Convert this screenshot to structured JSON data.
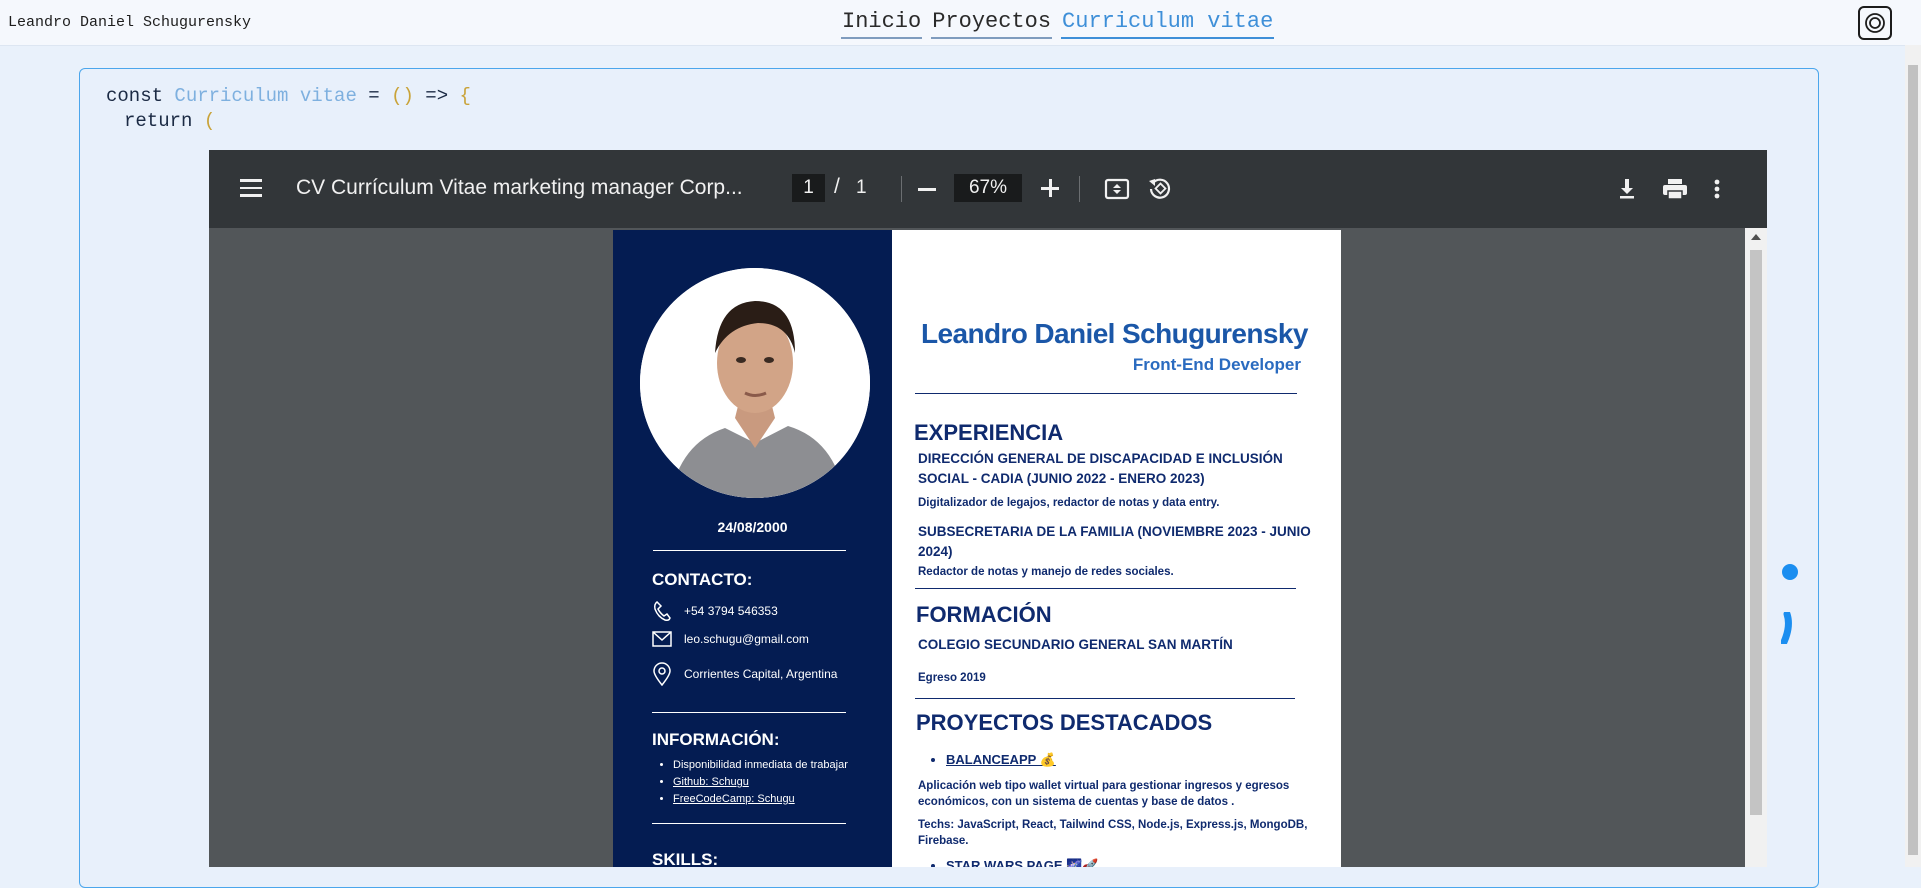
{
  "site": {
    "owner_name": "Leandro Daniel Schugurensky",
    "nav": [
      "Inicio",
      "Proyectos",
      "Curriculum vitae"
    ],
    "active_nav": "Curriculum vitae"
  },
  "code": {
    "keyword": "const",
    "component": "Curriculum vitae",
    "assign": "=",
    "parens": "()",
    "arrow": "=>",
    "brace": "{",
    "return_kw": "return",
    "open_paren": "("
  },
  "pdf_viewer": {
    "title": "CV Currículum Vitae marketing manager Corp...",
    "current_page": "1",
    "page_separator": "/",
    "total_pages": "1",
    "zoom": "67%",
    "icons": [
      "menu-icon",
      "zoom-out-icon",
      "zoom-in-icon",
      "fit-page-icon",
      "rotate-icon",
      "download-icon",
      "print-icon",
      "more-options-icon"
    ]
  },
  "cv": {
    "name": "Leandro Daniel Schugurensky",
    "role": "Front-End Developer",
    "dob": "24/08/2000",
    "contact_heading": "CONTACTO:",
    "phone": "+54 3794 546353",
    "email": "leo.schugu@gmail.com",
    "location": "Corrientes Capital, Argentina",
    "info_heading": "INFORMACIÓN:",
    "info_items": [
      "Disponibilidad inmediata de trabajar",
      "Github: Schugu",
      "FreeCodeCamp: Schugu"
    ],
    "skills_heading": "SKILLS:",
    "experience_heading": "EXPERIENCIA",
    "jobs": [
      {
        "title": "DIRECCIÓN GENERAL DE DISCAPACIDAD E INCLUSIÓN SOCIAL - CADIA (JUNIO 2022 - ENERO 2023)",
        "desc": "Digitalizador de legajos, redactor de notas y data entry."
      },
      {
        "title": "SUBSECRETARIA DE LA FAMILIA (NOVIEMBRE 2023 - JUNIO 2024)",
        "desc": "Redactor de notas y manejo de redes sociales."
      }
    ],
    "education_heading": "FORMACIÓN",
    "school": "COLEGIO SECUNDARIO GENERAL SAN MARTÍN",
    "graduation": "Egreso 2019",
    "projects_heading": "PROYECTOS DESTACADOS",
    "projects": [
      {
        "name": "BALANCEAPP 💰",
        "desc": "Aplicación web tipo wallet virtual para gestionar ingresos y egresos económicos, con un sistema de cuentas y base de datos .",
        "techs": "Techs: JavaScript, React, Tailwind CSS, Node.js, Express.js, MongoDB, Firebase."
      },
      {
        "name": "STAR WARS PAGE 🌌🚀"
      }
    ]
  },
  "closing": ")"
}
